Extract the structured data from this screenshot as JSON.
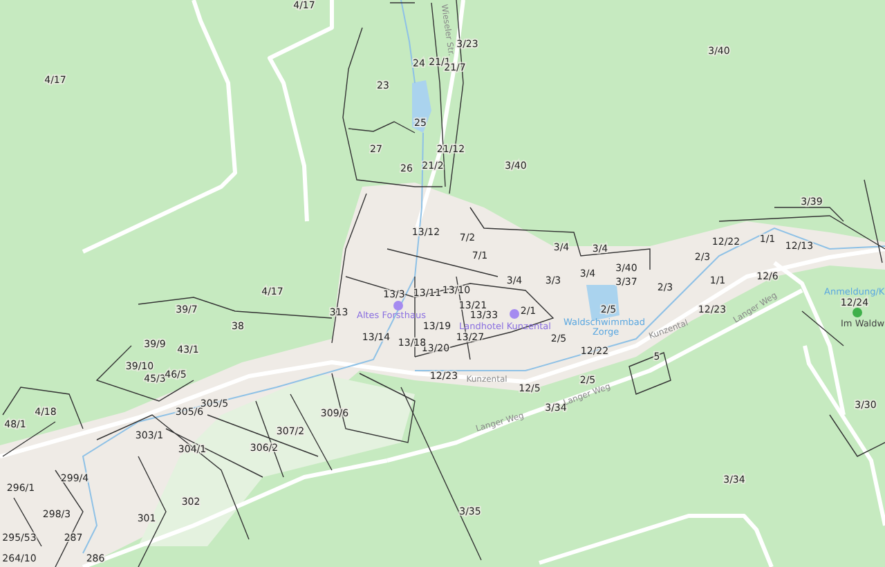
{
  "map": {
    "parcels": [
      {
        "label": "4/17"
      },
      {
        "label": "4/17"
      },
      {
        "label": "4/17"
      },
      {
        "label": "3/23"
      },
      {
        "label": "3/40"
      },
      {
        "label": "3/40"
      },
      {
        "label": "23"
      },
      {
        "label": "24"
      },
      {
        "label": "21/1"
      },
      {
        "label": "21/7"
      },
      {
        "label": "25"
      },
      {
        "label": "27"
      },
      {
        "label": "26"
      },
      {
        "label": "21/2"
      },
      {
        "label": "21/12"
      },
      {
        "label": "3/39"
      },
      {
        "label": "3/4"
      },
      {
        "label": "3/4"
      },
      {
        "label": "3/4"
      },
      {
        "label": "3/3"
      },
      {
        "label": "2/5"
      },
      {
        "label": "2/5"
      },
      {
        "label": "12/22"
      },
      {
        "label": "1/1"
      },
      {
        "label": "1/1"
      },
      {
        "label": "12/6"
      },
      {
        "label": "12/23"
      },
      {
        "label": "12/24"
      },
      {
        "label": "12/22"
      },
      {
        "label": "5"
      },
      {
        "label": "2/5"
      },
      {
        "label": "3/34"
      },
      {
        "label": "3/34"
      },
      {
        "label": "3/35"
      },
      {
        "label": "3/30"
      },
      {
        "label": "12/5"
      },
      {
        "label": "2/3"
      },
      {
        "label": "2/3"
      },
      {
        "label": "3/37"
      },
      {
        "label": "2/1"
      },
      {
        "label": "13/33"
      },
      {
        "label": "13/21"
      },
      {
        "label": "13/27"
      },
      {
        "label": "13/19"
      },
      {
        "label": "13/20"
      },
      {
        "label": "13/18"
      },
      {
        "label": "13/3"
      },
      {
        "label": "13/11"
      },
      {
        "label": "13/10"
      },
      {
        "label": "13/12"
      },
      {
        "label": "7/2"
      },
      {
        "label": "7/1"
      },
      {
        "label": "3/4"
      },
      {
        "label": "12/23"
      },
      {
        "label": "309/6"
      },
      {
        "label": "307/2"
      },
      {
        "label": "306/2"
      },
      {
        "label": "305/6"
      },
      {
        "label": "305/5"
      },
      {
        "label": "304/1"
      },
      {
        "label": "302"
      },
      {
        "label": "301"
      },
      {
        "label": "4/18"
      },
      {
        "label": "48/1"
      },
      {
        "label": "299/4"
      },
      {
        "label": "296/1"
      },
      {
        "label": "298/3"
      },
      {
        "label": "295/53"
      },
      {
        "label": "287"
      },
      {
        "label": "264/10"
      },
      {
        "label": "286"
      },
      {
        "label": "39/9"
      },
      {
        "label": "39/10"
      },
      {
        "label": "39/7"
      },
      {
        "label": "38"
      },
      {
        "label": "45/3"
      },
      {
        "label": "46/5"
      },
      {
        "label": "43/1"
      },
      {
        "label": "303/1"
      },
      {
        "label": "313"
      },
      {
        "label": "13/14"
      },
      {
        "label": "3/40"
      },
      {
        "label": "12/13"
      }
    ],
    "streets": [
      {
        "name": "Wieseler Str."
      },
      {
        "name": "Langer Weg"
      },
      {
        "name": "Langer Weg"
      },
      {
        "name": "Langer Weg"
      },
      {
        "name": "Kunzental"
      },
      {
        "name": "Kunzental"
      }
    ],
    "places": [
      {
        "name": "Altes Forsthaus",
        "kind": "poi"
      },
      {
        "name": "Landhotel Kunzental",
        "kind": "poi"
      },
      {
        "name": "Waldschwimmbad Zorge",
        "kind": "water"
      },
      {
        "name": "Anmeldung/K",
        "kind": "camp"
      },
      {
        "name": "Im Waldw",
        "kind": "label"
      }
    ]
  }
}
